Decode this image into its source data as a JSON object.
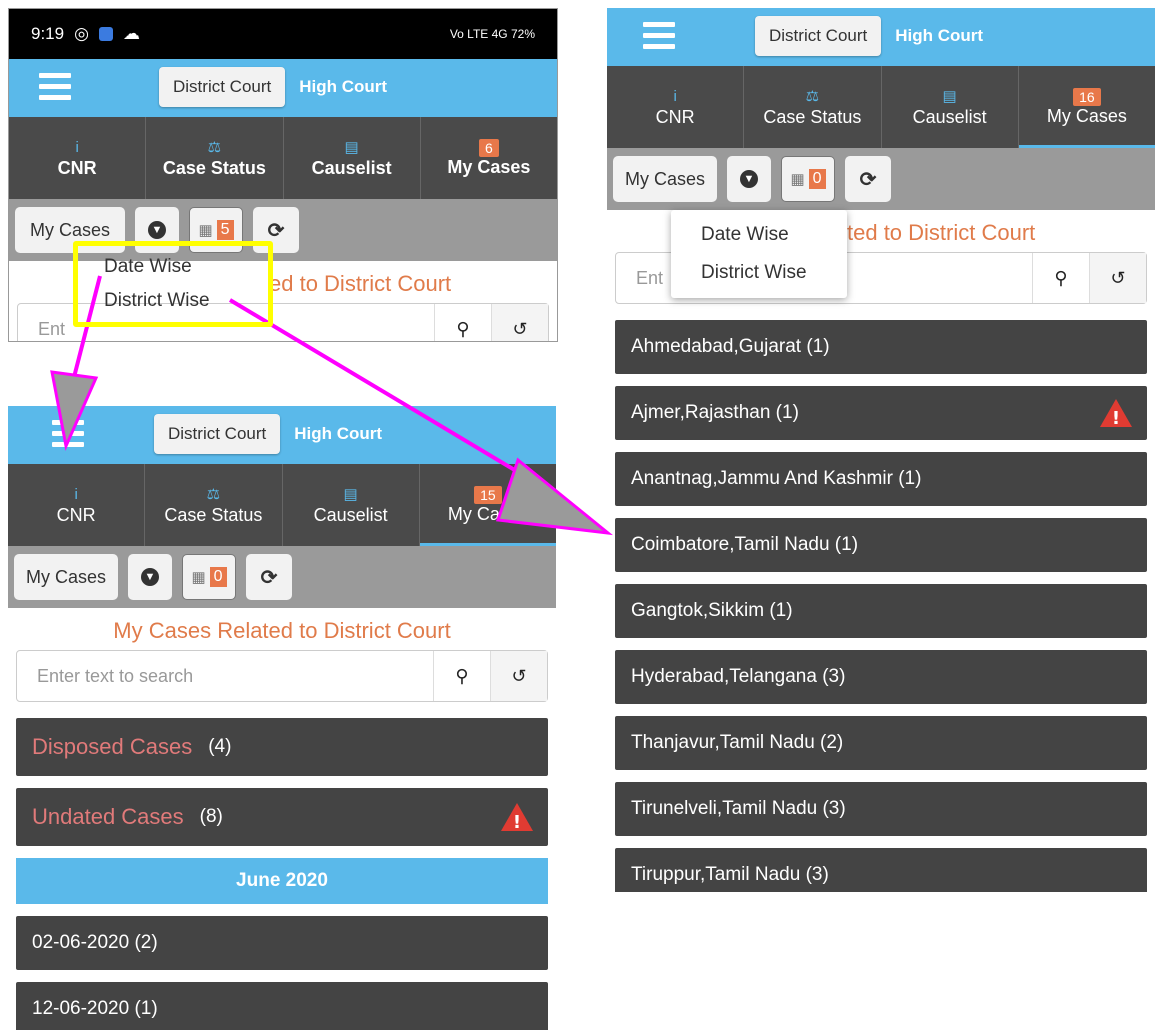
{
  "status_bar": {
    "time": "9:19",
    "right_text": "Vo LTE  4G  72%"
  },
  "court_tabs": {
    "district": "District Court",
    "high": "High Court"
  },
  "nav_tabs": {
    "cnr": "CNR",
    "case_status": "Case Status",
    "causelist": "Causelist",
    "my_cases": "My Cases"
  },
  "toolbar": {
    "my_cases": "My Cases"
  },
  "dropdown": {
    "date_wise": "Date Wise",
    "district_wise": "District Wise"
  },
  "panel1": {
    "badge": "6",
    "cal_count": "5",
    "heading_partial": "ed to District Court",
    "search_partial": "Ent"
  },
  "panel2": {
    "badge": "15",
    "cal_count": "0",
    "heading": "My Cases Related to District Court",
    "search_placeholder": "Enter text to search",
    "disposed_label": "Disposed Cases",
    "disposed_count": "(4)",
    "undated_label": "Undated Cases",
    "undated_count": "(8)",
    "month": "June 2020",
    "dates": [
      "02-06-2020 (2)",
      "12-06-2020 (1)"
    ]
  },
  "panel3": {
    "badge": "16",
    "cal_count": "0",
    "heading_partial": "ted to District Court",
    "search_partial": "Ent",
    "districts": [
      "Ahmedabad,Gujarat (1)",
      "Ajmer,Rajasthan (1)",
      "Anantnag,Jammu And Kashmir (1)",
      "Coimbatore,Tamil Nadu (1)",
      "Gangtok,Sikkim (1)",
      "Hyderabad,Telangana (3)",
      "Thanjavur,Tamil Nadu (2)",
      "Tirunelveli,Tamil Nadu (3)",
      "Tiruppur,Tamil Nadu (3)"
    ]
  },
  "colors": {
    "accent": "#5ab9ea",
    "dark": "#4a4a4a",
    "orange": "#e8784a",
    "highlight": "#ffff00",
    "arrow": "#ff00ff"
  }
}
